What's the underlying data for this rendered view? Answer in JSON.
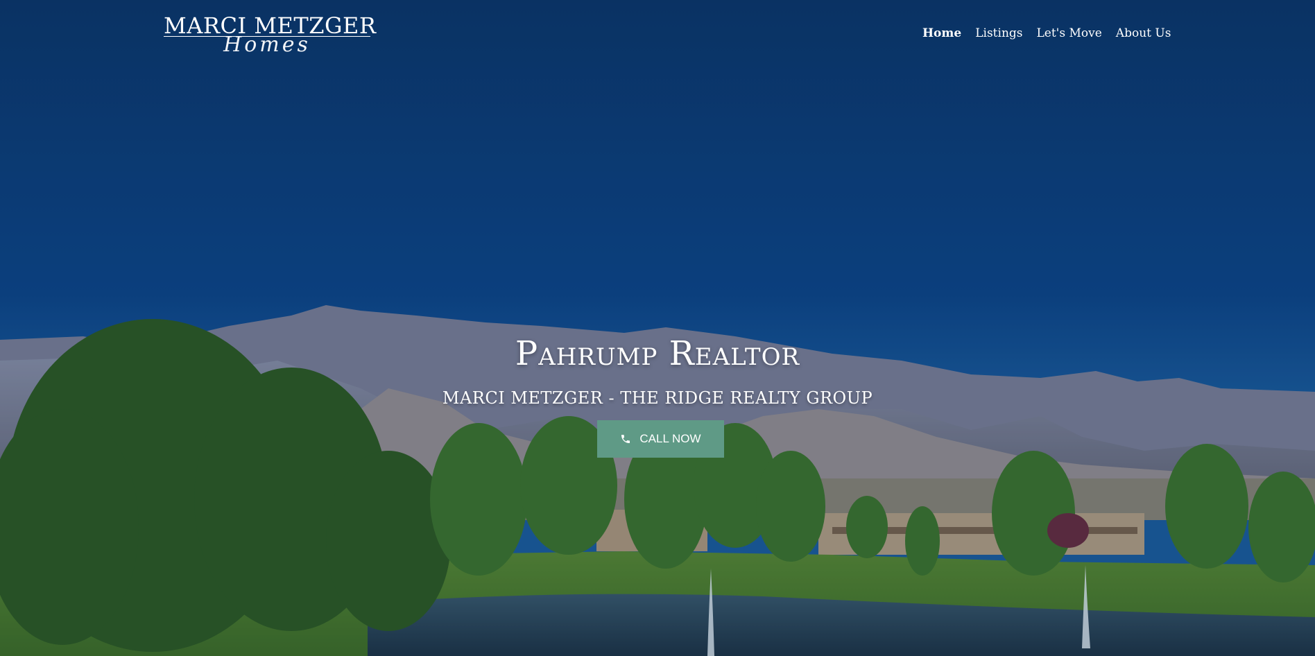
{
  "logo": {
    "main": "MARCI METZGER",
    "script": "Homes"
  },
  "nav": {
    "items": [
      {
        "label": "Home",
        "active": true
      },
      {
        "label": "Listings",
        "active": false
      },
      {
        "label": "Let's Move",
        "active": false
      },
      {
        "label": "About Us",
        "active": false
      }
    ]
  },
  "hero": {
    "title": "Pahrump Realtor",
    "subtitle": "MARCI METZGER - THE RIDGE REALTY GROUP",
    "cta_label": "CALL NOW",
    "cta_icon": "phone-icon"
  },
  "colors": {
    "sky": "#0a3a78",
    "cta": "#5f9a86",
    "text": "#ffffff"
  }
}
